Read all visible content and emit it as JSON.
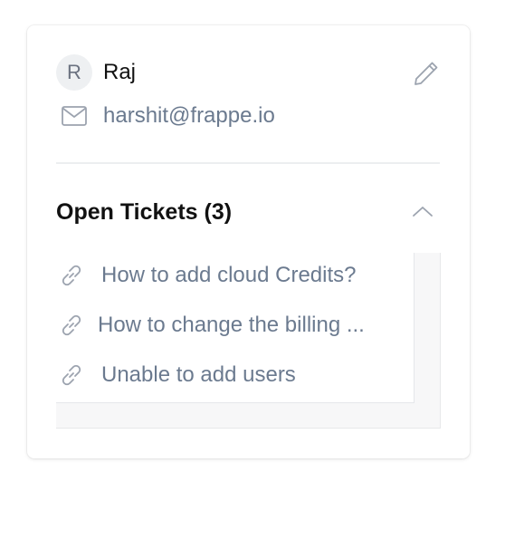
{
  "contact": {
    "avatar_initial": "R",
    "name": "Raj",
    "email": "harshit@frappe.io"
  },
  "open_tickets": {
    "title": "Open Tickets (3)",
    "expanded": true,
    "items": [
      {
        "label": "How to add cloud Credits?"
      },
      {
        "label": "How to change the billing ..."
      },
      {
        "label": "Unable to add users"
      }
    ]
  },
  "icons": {
    "edit": "pencil-icon",
    "email": "mail-icon",
    "collapse": "chevron-up-icon",
    "ticket": "link-icon"
  },
  "colors": {
    "text_primary": "#111111",
    "text_muted": "#6b7a8f",
    "icon": "#9ca3af",
    "avatar_bg": "#eef0f2"
  }
}
